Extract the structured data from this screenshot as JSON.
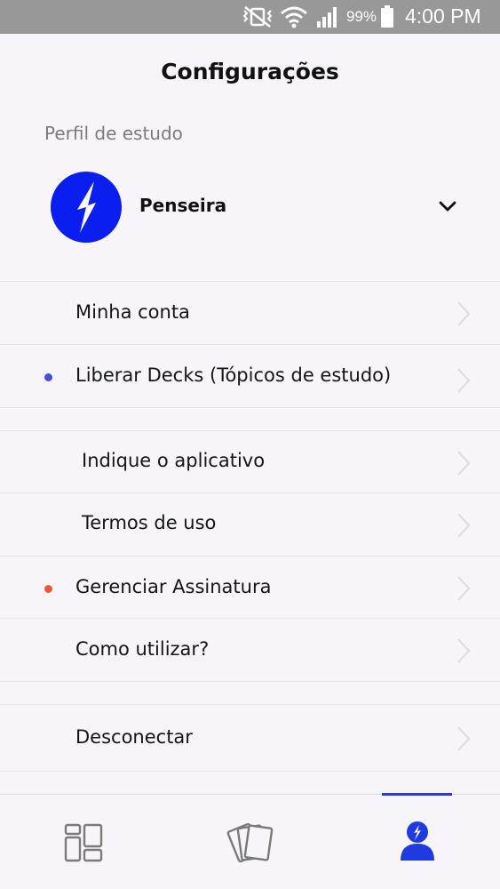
{
  "status_bar": {
    "battery_percent": "99%",
    "time": "4:00 PM",
    "icons": [
      "mute-vibrate-icon",
      "wifi-icon",
      "signal-icon",
      "battery-icon"
    ]
  },
  "header": {
    "title": "Configurações"
  },
  "profile": {
    "section_label": "Perfil de estudo",
    "name": "Penseira",
    "logo_color": "#0a1ef0"
  },
  "menu": {
    "items": [
      {
        "label": "Minha conta",
        "dot": false
      },
      {
        "label": "Liberar Decks (Tópicos de estudo)",
        "dot": true,
        "dot_color": "#4a4fd1"
      },
      {
        "label": "Indique o aplicativo",
        "dot": false
      },
      {
        "label": "Termos de uso",
        "dot": false
      },
      {
        "label": "Gerenciar Assinatura",
        "dot": true,
        "dot_color": "#e8593f"
      },
      {
        "label": "Como utilizar?",
        "dot": false
      },
      {
        "label": "Desconectar",
        "dot": false
      }
    ]
  },
  "bottom_nav": {
    "tabs": [
      {
        "icon": "dashboard-grid-icon",
        "active": false
      },
      {
        "icon": "cards-deck-icon",
        "active": false
      },
      {
        "icon": "profile-user-icon",
        "active": true
      }
    ],
    "active_color": "#1f3be0"
  }
}
